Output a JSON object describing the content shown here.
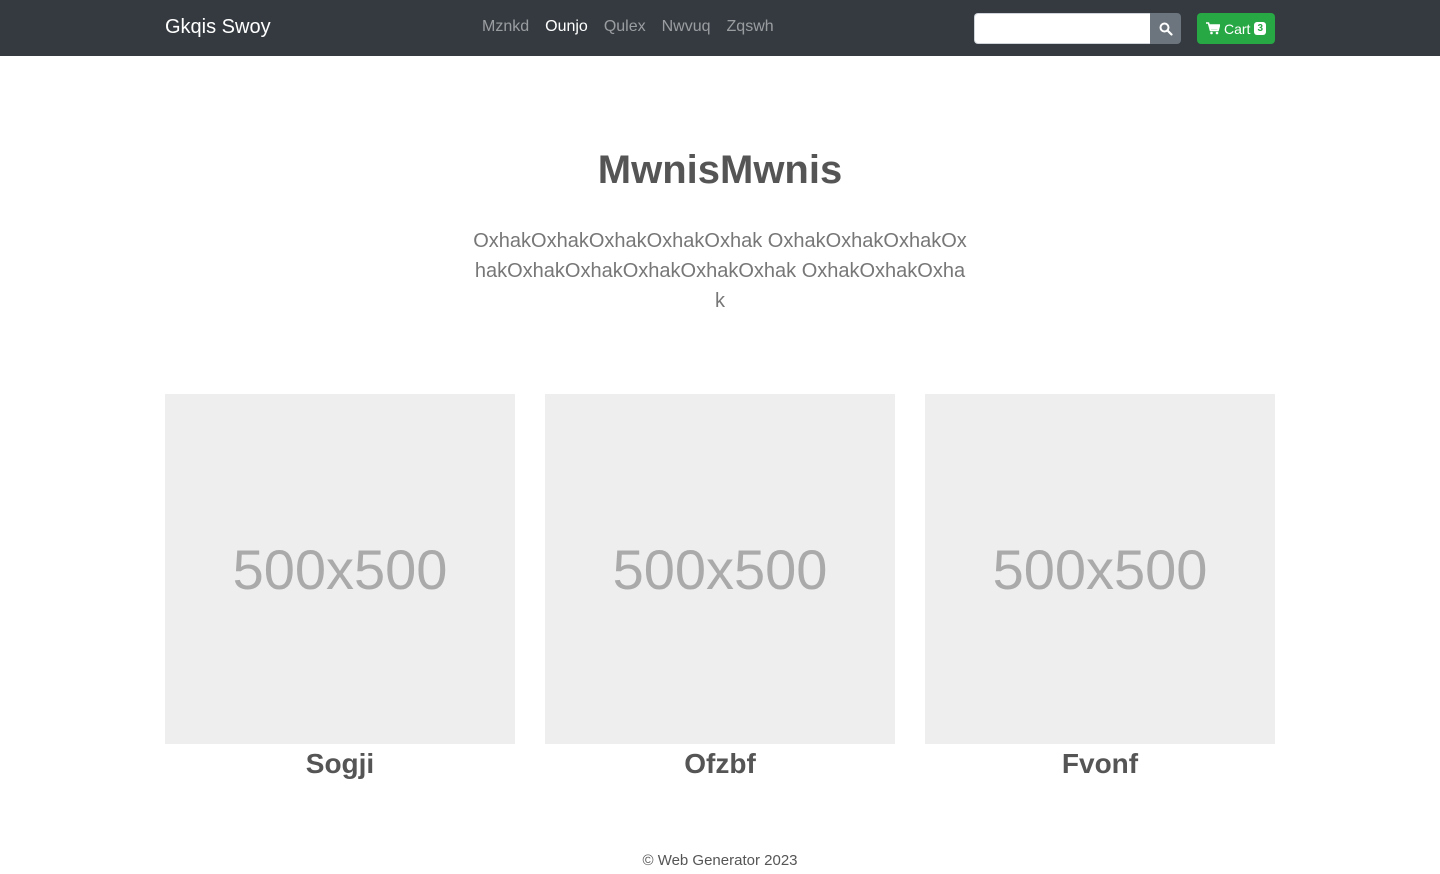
{
  "navbar": {
    "brand": "Gkqis Swoy",
    "links": [
      {
        "label": "Mznkd"
      },
      {
        "label": "Ounjo"
      },
      {
        "label": "Qulex"
      },
      {
        "label": "Nwvuq"
      },
      {
        "label": "Zqswh"
      }
    ],
    "active_link": "Ounjo",
    "search": {
      "value": "",
      "placeholder": "",
      "icon": "search-icon"
    },
    "cart": {
      "label": "Cart",
      "count": "3",
      "icon": "shopping-cart-icon"
    },
    "colors": {
      "background": "#343a40",
      "cart_button": "#28a745",
      "search_button": "#6c757d"
    }
  },
  "hero": {
    "title": "MwnisMwnis",
    "text": "OxhakOxhakOxhakOxhakOxhak OxhakOxhakOxhakOxhakOxhakOxhakOxhakOxhakOxhak OxhakOxhakOxhak"
  },
  "cards": [
    {
      "image_text": "500x500",
      "title": "Sogji"
    },
    {
      "image_text": "500x500",
      "title": "Ofzbf"
    },
    {
      "image_text": "500x500",
      "title": "Fvonf"
    }
  ],
  "footer": {
    "text": "© Web Generator 2023"
  }
}
